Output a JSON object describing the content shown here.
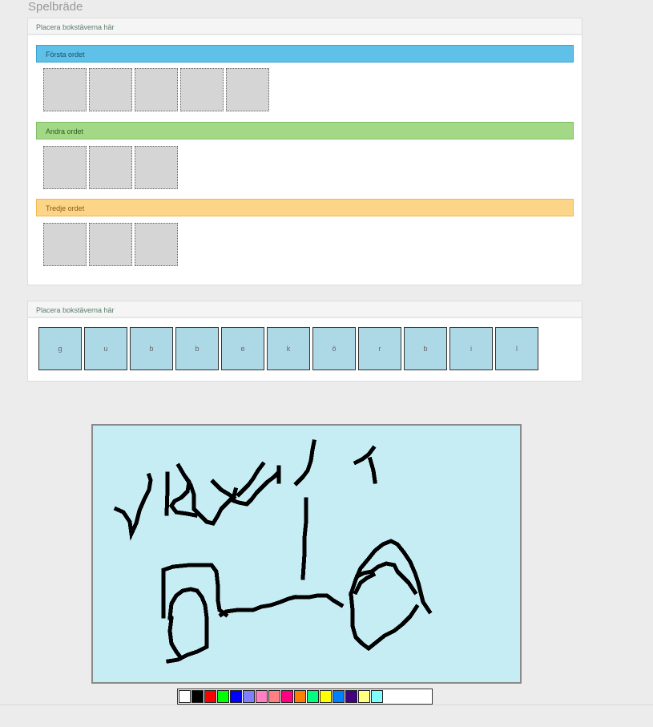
{
  "page_title": "Spelbräde",
  "board": {
    "heading": "Placera bokstäverna här",
    "words": [
      {
        "label": "Första ordet",
        "slots": 5,
        "color": "#5fc0e8"
      },
      {
        "label": "Andra ordet",
        "slots": 3,
        "color": "#a3d886"
      },
      {
        "label": "Tredje ordet",
        "slots": 3,
        "color": "#fcd589"
      }
    ]
  },
  "letters": {
    "heading": "Placera bokstäverna här",
    "tiles": [
      "g",
      "u",
      "b",
      "b",
      "e",
      "k",
      "ö",
      "r",
      "b",
      "i",
      "l"
    ]
  },
  "drawing": {
    "background_color": "#c6edf4",
    "stroke_color": "#000000"
  },
  "palette": {
    "colors": [
      "#ffffff",
      "#000000",
      "#ff0000",
      "#00ff00",
      "#0000ff",
      "#8080ff",
      "#ff80c0",
      "#ff8080",
      "#ff0080",
      "#ff8000",
      "#00ff80",
      "#ffff00",
      "#0080ff",
      "#400080",
      "#ffff80",
      "#80ffff"
    ],
    "selected": "#000000"
  }
}
